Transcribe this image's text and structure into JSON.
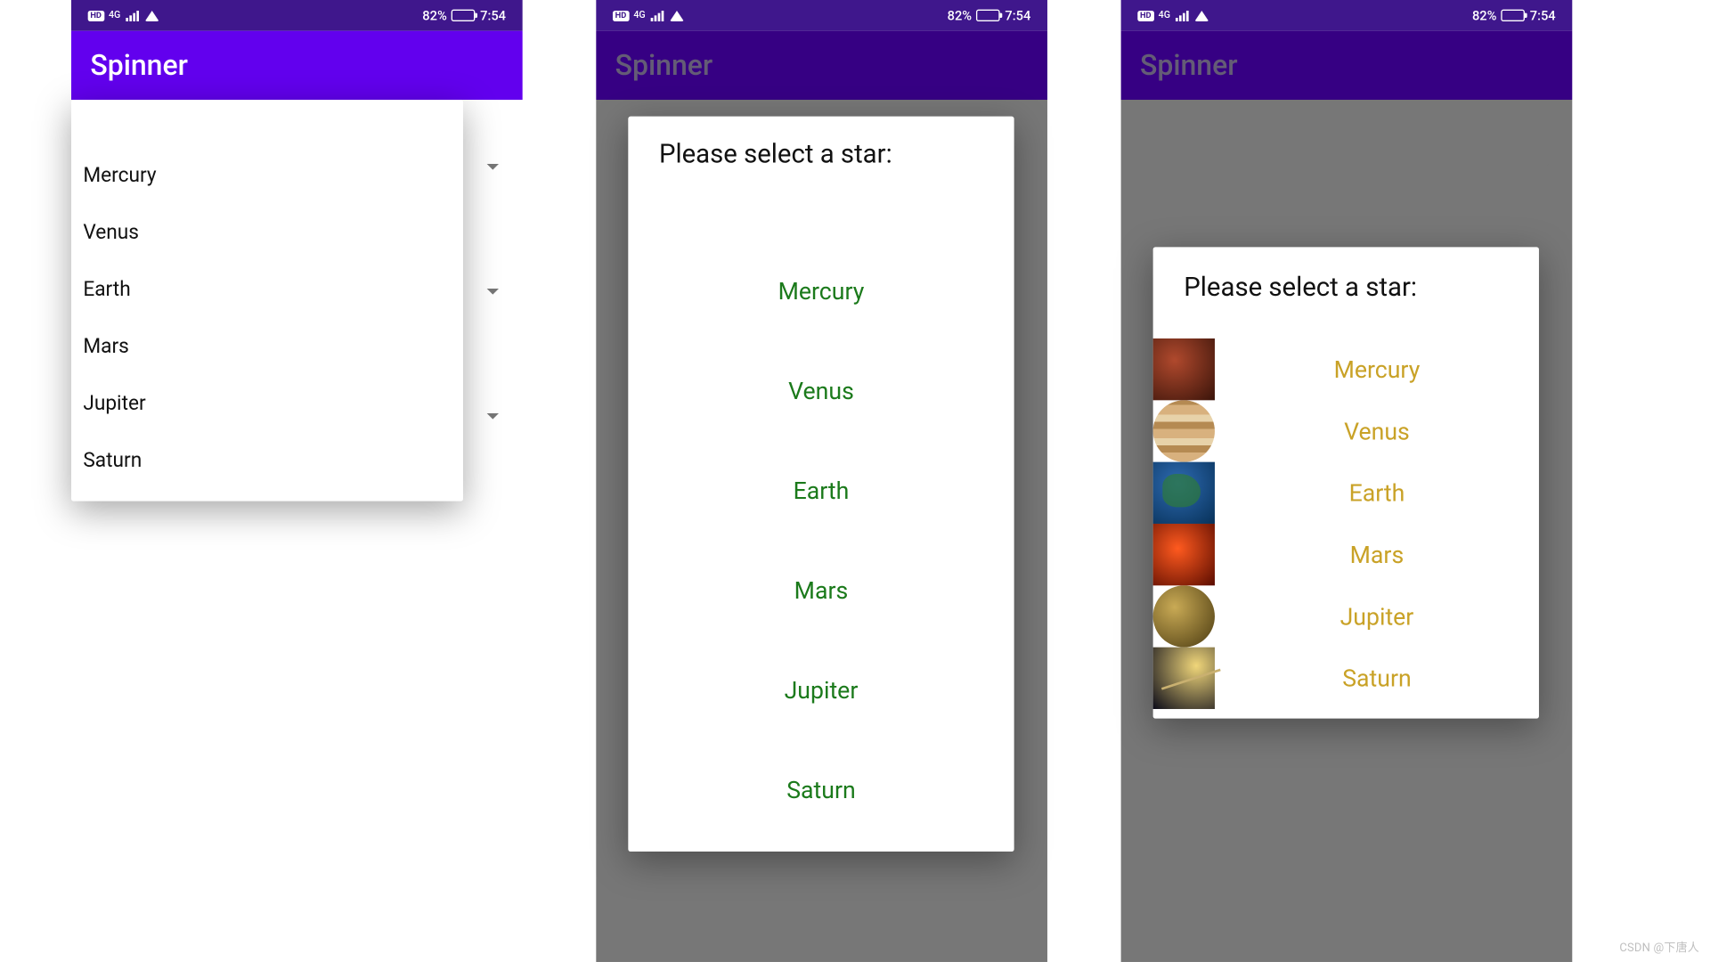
{
  "status": {
    "battery_pct": "82%",
    "time": "7:54",
    "net_label": "4G"
  },
  "appbar": {
    "title": "Spinner"
  },
  "dialog_title": "Please select a star:",
  "planets": [
    "Mercury",
    "Venus",
    "Earth",
    "Mars",
    "Jupiter",
    "Saturn"
  ],
  "watermark": "CSDN @下唐人"
}
